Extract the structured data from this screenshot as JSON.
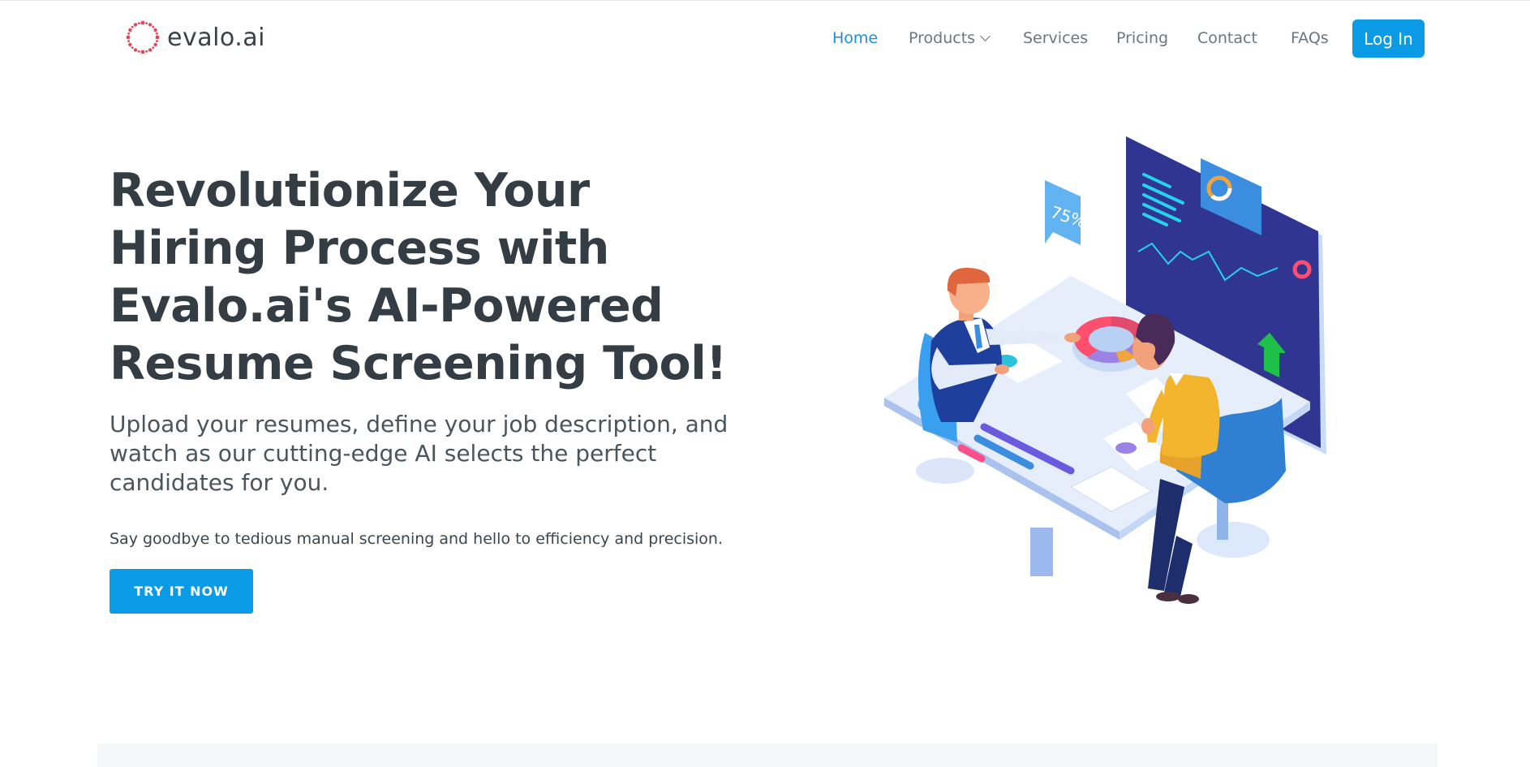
{
  "brand": {
    "name": "evalo.ai",
    "logo_color": "#e2465c"
  },
  "nav": {
    "items": [
      {
        "label": "Home",
        "active": true
      },
      {
        "label": "Products",
        "has_dropdown": true,
        "icon": "chevron-down-icon"
      },
      {
        "label": "Services"
      },
      {
        "label": "Pricing"
      },
      {
        "label": "Contact"
      },
      {
        "label": "FAQs"
      }
    ],
    "login_label": "Log In"
  },
  "hero": {
    "title": "Revolutionize Your Hiring Process with Evalo.ai's AI-Powered Resume Screening Tool!",
    "subtitle": "Upload your resumes, define your job description, and watch as our cutting-edge AI selects the perfect candidates for you.",
    "tagline": "Say goodbye to tedious manual screening and hello to efficiency and precision.",
    "cta_label": "TRY IT NOW"
  },
  "illustration": {
    "bubble_text": "75%"
  },
  "colors": {
    "accent": "#0b9be6",
    "nav_active": "#1a8fd8",
    "text_dark": "#333d43"
  }
}
